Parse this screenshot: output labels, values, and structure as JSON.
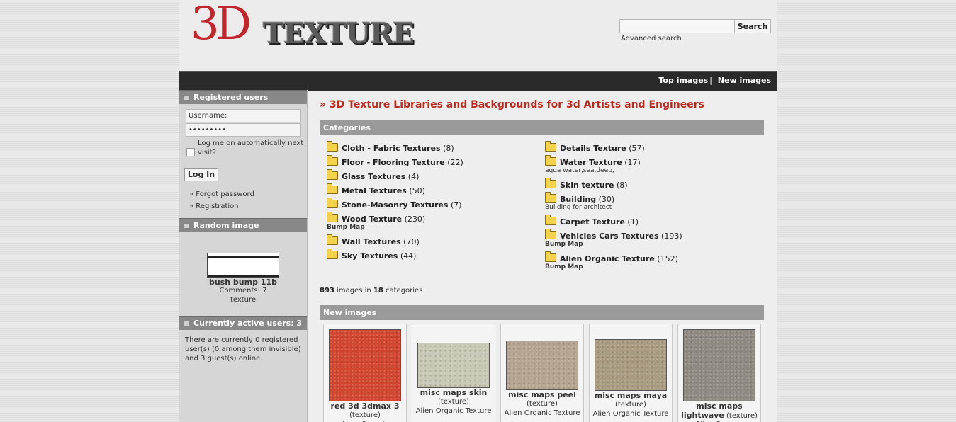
{
  "header": {
    "logo_text_3d": "3D",
    "logo_text_texture": "TEXTURE",
    "search_button": "Search",
    "advanced_search": "Advanced search"
  },
  "nav": {
    "top_images": "Top images",
    "separator": "|",
    "new_images": "New images"
  },
  "sidebar": {
    "registered_users_title": "Registered users",
    "username_placeholder": "Username:",
    "password_value": "•••••••••",
    "remember_label": "Log me on automatically next visit?",
    "login_button": "Log In",
    "forgot_password": "» Forgot password",
    "registration": "» Registration",
    "random_image_title": "Random image",
    "random_image_name": "bush bump 11b",
    "random_image_comments": "Comments: 7",
    "random_image_category": "texture",
    "active_users_title": "Currently active users: 3",
    "active_users_text": "There are currently 0 registered user(s) (0 among them invisible) and 3 guest(s) online."
  },
  "main": {
    "title": "» 3D Texture Libraries and Backgrounds for 3d Artists and Engineers",
    "categories_title": "Categories",
    "categories_left": [
      {
        "name": "Cloth - Fabric Textures",
        "count": "(8)",
        "sub": ""
      },
      {
        "name": "Floor - Flooring Texture",
        "count": "(22)",
        "sub": ""
      },
      {
        "name": "Glass Textures",
        "count": "(4)",
        "sub": ""
      },
      {
        "name": "Metal Textures",
        "count": "(50)",
        "sub": ""
      },
      {
        "name": "Stone-Masonry Textures",
        "count": "(7)",
        "sub": ""
      },
      {
        "name": "Wood Texture",
        "count": "(230)",
        "sub": "Bump Map"
      },
      {
        "name": "Wall Textures",
        "count": "(70)",
        "sub": ""
      },
      {
        "name": "Sky Textures",
        "count": "(44)",
        "sub": ""
      }
    ],
    "categories_right": [
      {
        "name": "Details Texture",
        "count": "(57)",
        "sub": ""
      },
      {
        "name": "Water Texture",
        "count": "(17)",
        "sub": "aqua water,sea,deep,"
      },
      {
        "name": "Skin texture",
        "count": "(8)",
        "sub": ""
      },
      {
        "name": "Building",
        "count": "(30)",
        "sub": "Building for architect"
      },
      {
        "name": "Carpet Texture",
        "count": "(1)",
        "sub": ""
      },
      {
        "name": "Vehicles Cars Textures",
        "count": "(193)",
        "sub": "Bump Map"
      },
      {
        "name": "Alien Organic Texture",
        "count": "(152)",
        "sub": "Bump Map"
      }
    ],
    "summary_images": "893",
    "summary_mid": " images in ",
    "summary_categories": "18",
    "summary_end": " categories.",
    "new_images_title": "New images",
    "new_images": [
      {
        "title": "red 3d 3dmax 3",
        "type": "(texture)",
        "category": "Alien Organic",
        "color": "#d2462f"
      },
      {
        "title": "misc maps skin",
        "type": "(texture)",
        "category": "Alien Organic Texture",
        "color": "#c9c7b6"
      },
      {
        "title": "misc maps peel",
        "type": "(texture)",
        "category": "Alien Organic Texture",
        "color": "#b5a590"
      },
      {
        "title": "misc maps maya",
        "type": "(texture)",
        "category": "Alien Organic Texture",
        "color": "#a89b80"
      },
      {
        "title": "misc maps",
        "title2": "lightwave",
        "type": "(texture)",
        "category": "Alien Organic",
        "color": "#8e8a82"
      }
    ]
  }
}
